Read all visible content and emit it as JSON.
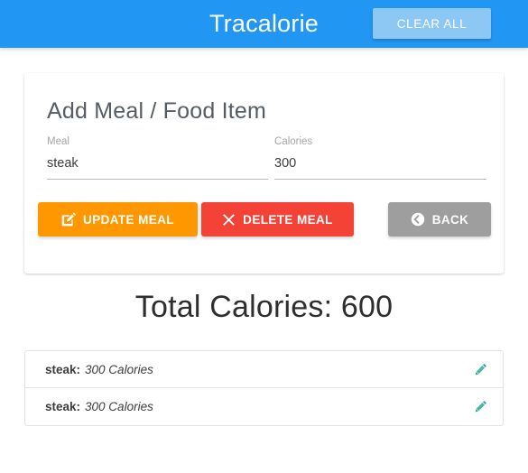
{
  "header": {
    "brand": "Tracalorie",
    "clear_all_label": "CLEAR ALL",
    "background_color": "#2196f3",
    "clear_all_color": "#8dc8f5"
  },
  "card": {
    "title": "Add Meal / Food Item",
    "fields": [
      {
        "label": "Meal",
        "value": "steak",
        "placeholder": "Add meal",
        "name": "meal"
      },
      {
        "label": "Calories",
        "value": "300",
        "placeholder": "Add calories",
        "name": "calories"
      }
    ],
    "buttons": [
      {
        "label": "Update Meal",
        "icon": "edit-pen-square-icon",
        "color": "#ff9800"
      },
      {
        "label": "Delete Meal",
        "icon": "times-x-icon",
        "color": "#f44336"
      },
      {
        "label": "Back",
        "icon": "circle-chevron-left-icon",
        "color": "#9e9e9e"
      }
    ]
  },
  "total": {
    "label": "Total Calories:",
    "value": "600",
    "text": "Total Calories: 600"
  },
  "meal_list": {
    "edit_icon_color": "#26a69a",
    "items": [
      {
        "name": "steak:",
        "calories": "300 Calories",
        "edit_icon": "pencil-icon"
      },
      {
        "name": "steak:",
        "calories": "300 Calories",
        "edit_icon": "pencil-icon"
      }
    ]
  }
}
